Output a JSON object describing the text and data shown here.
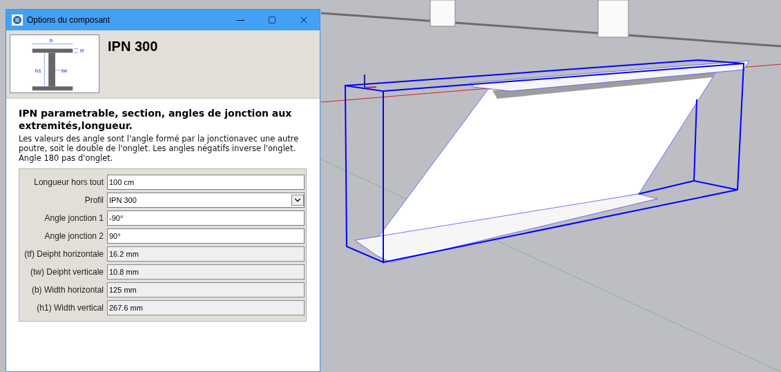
{
  "window": {
    "title": "Options du composant"
  },
  "section_diagram": {
    "labels": [
      "b",
      "tf",
      "h1",
      "tw"
    ]
  },
  "component": {
    "name": "IPN 300",
    "heading": "IPN parametrable, section, angles de jonction aux extremités,longueur.",
    "description": "Les valeurs des angle sont l'angle formé par la jonctionavec une autre poutre, soit le double de l'onglet. Les angles négatifs inverse l'onglet. Angle 180 pas d'onglet."
  },
  "fields": [
    {
      "label": "Longueur hors tout",
      "value": "100 cm",
      "kind": "text"
    },
    {
      "label": "Profil",
      "value": "IPN 300",
      "kind": "select"
    },
    {
      "label": "Angle jonction 1",
      "value": "-90°",
      "kind": "text"
    },
    {
      "label": "Angle jonction 2",
      "value": "90°",
      "kind": "text"
    },
    {
      "label": "(tf) Deipht horizontale",
      "value": "16.2 mm",
      "kind": "readonly"
    },
    {
      "label": "(tw) Deipht verticale",
      "value": "10.8 mm",
      "kind": "readonly"
    },
    {
      "label": "(b) Width horizontal",
      "value": "125 mm",
      "kind": "readonly"
    },
    {
      "label": "(h1) Width vertical",
      "value": "267.6 mm",
      "kind": "readonly"
    }
  ]
}
